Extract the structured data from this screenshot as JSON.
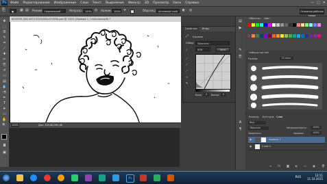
{
  "menubar": {
    "app_badge": "Ps",
    "items": [
      "Файл",
      "Редактирование",
      "Изображение",
      "Слои",
      "Текст",
      "Выделение",
      "Фильтр",
      "3D",
      "Просмотр",
      "Окно",
      "Справка"
    ],
    "window_buttons": [
      "—",
      "▢",
      "✕"
    ]
  },
  "options": {
    "mode_label": "Режим:",
    "mode_value": "Нормальный",
    "opacity_label": "Непрозр.:",
    "opacity_value": "100%",
    "flow_label": "Нажим:",
    "flow_value": "100%",
    "sample_label": "Образец:",
    "sample_value": "Активный слой",
    "workspace": "Основная рабочая среда"
  },
  "document": {
    "tab_title": "8f50f9f5-4f4f-4475-9f1f-b5f0cd7c5f6a.psd @ 100% (Кривые 1, Слой-маска/8) *",
    "zoom": "100%",
    "doc_info": "Док: 395,6K/395,6K"
  },
  "curves": {
    "tabs": [
      "Свойства",
      "Инфо"
    ],
    "title": "Кривые",
    "preset_label": "Набор:",
    "preset_value": "Заказная",
    "channel_value": "RGB",
    "auto_label": "Авто",
    "input_label": "Вход:",
    "output_label": "Выход:",
    "input_value": "0",
    "output_value": "0"
  },
  "swatches": {
    "tabs": [
      "Образцы",
      "Цвет"
    ],
    "colors": [
      "#ff0000",
      "#ffff00",
      "#00ff00",
      "#00ffff",
      "#0000ff",
      "#ff00ff",
      "#ffffff",
      "#c8c8c8",
      "#969696",
      "#646464",
      "#323232",
      "#000000",
      "#ff8080",
      "#ffe080",
      "#80ff80",
      "#80ffff",
      "#8080ff",
      "#ff80ff",
      "#804040",
      "#ff8040",
      "#408040",
      "#004080",
      "#8000ff",
      "#800040",
      "#f26522",
      "#f7941d",
      "#fff200",
      "#8dc63f",
      "#39b54a",
      "#00a99d",
      "#00aeef",
      "#0072bc",
      "#2e3192",
      "#662d91",
      "#92278f",
      "#ec008c"
    ]
  },
  "brushes": {
    "title": "Наборы кистей",
    "size_label": "Размер:",
    "size_value": "25 пикс."
  },
  "layers": {
    "tabs": [
      "Каналы",
      "Контуры",
      "Слои"
    ],
    "kind_label": "Вид",
    "blend_value": "Обычные",
    "opacity_label": "Непрозрачность:",
    "opacity_value": "100%",
    "lock_label": "Закрепить:",
    "fill_label": "Заливка:",
    "fill_value": "100%",
    "rows": [
      {
        "name": "Кривые 1"
      },
      {
        "name": "Слой 0"
      }
    ]
  },
  "taskbar": {
    "lang": "RUS",
    "time": "12:11",
    "date": "11.10.2015"
  }
}
